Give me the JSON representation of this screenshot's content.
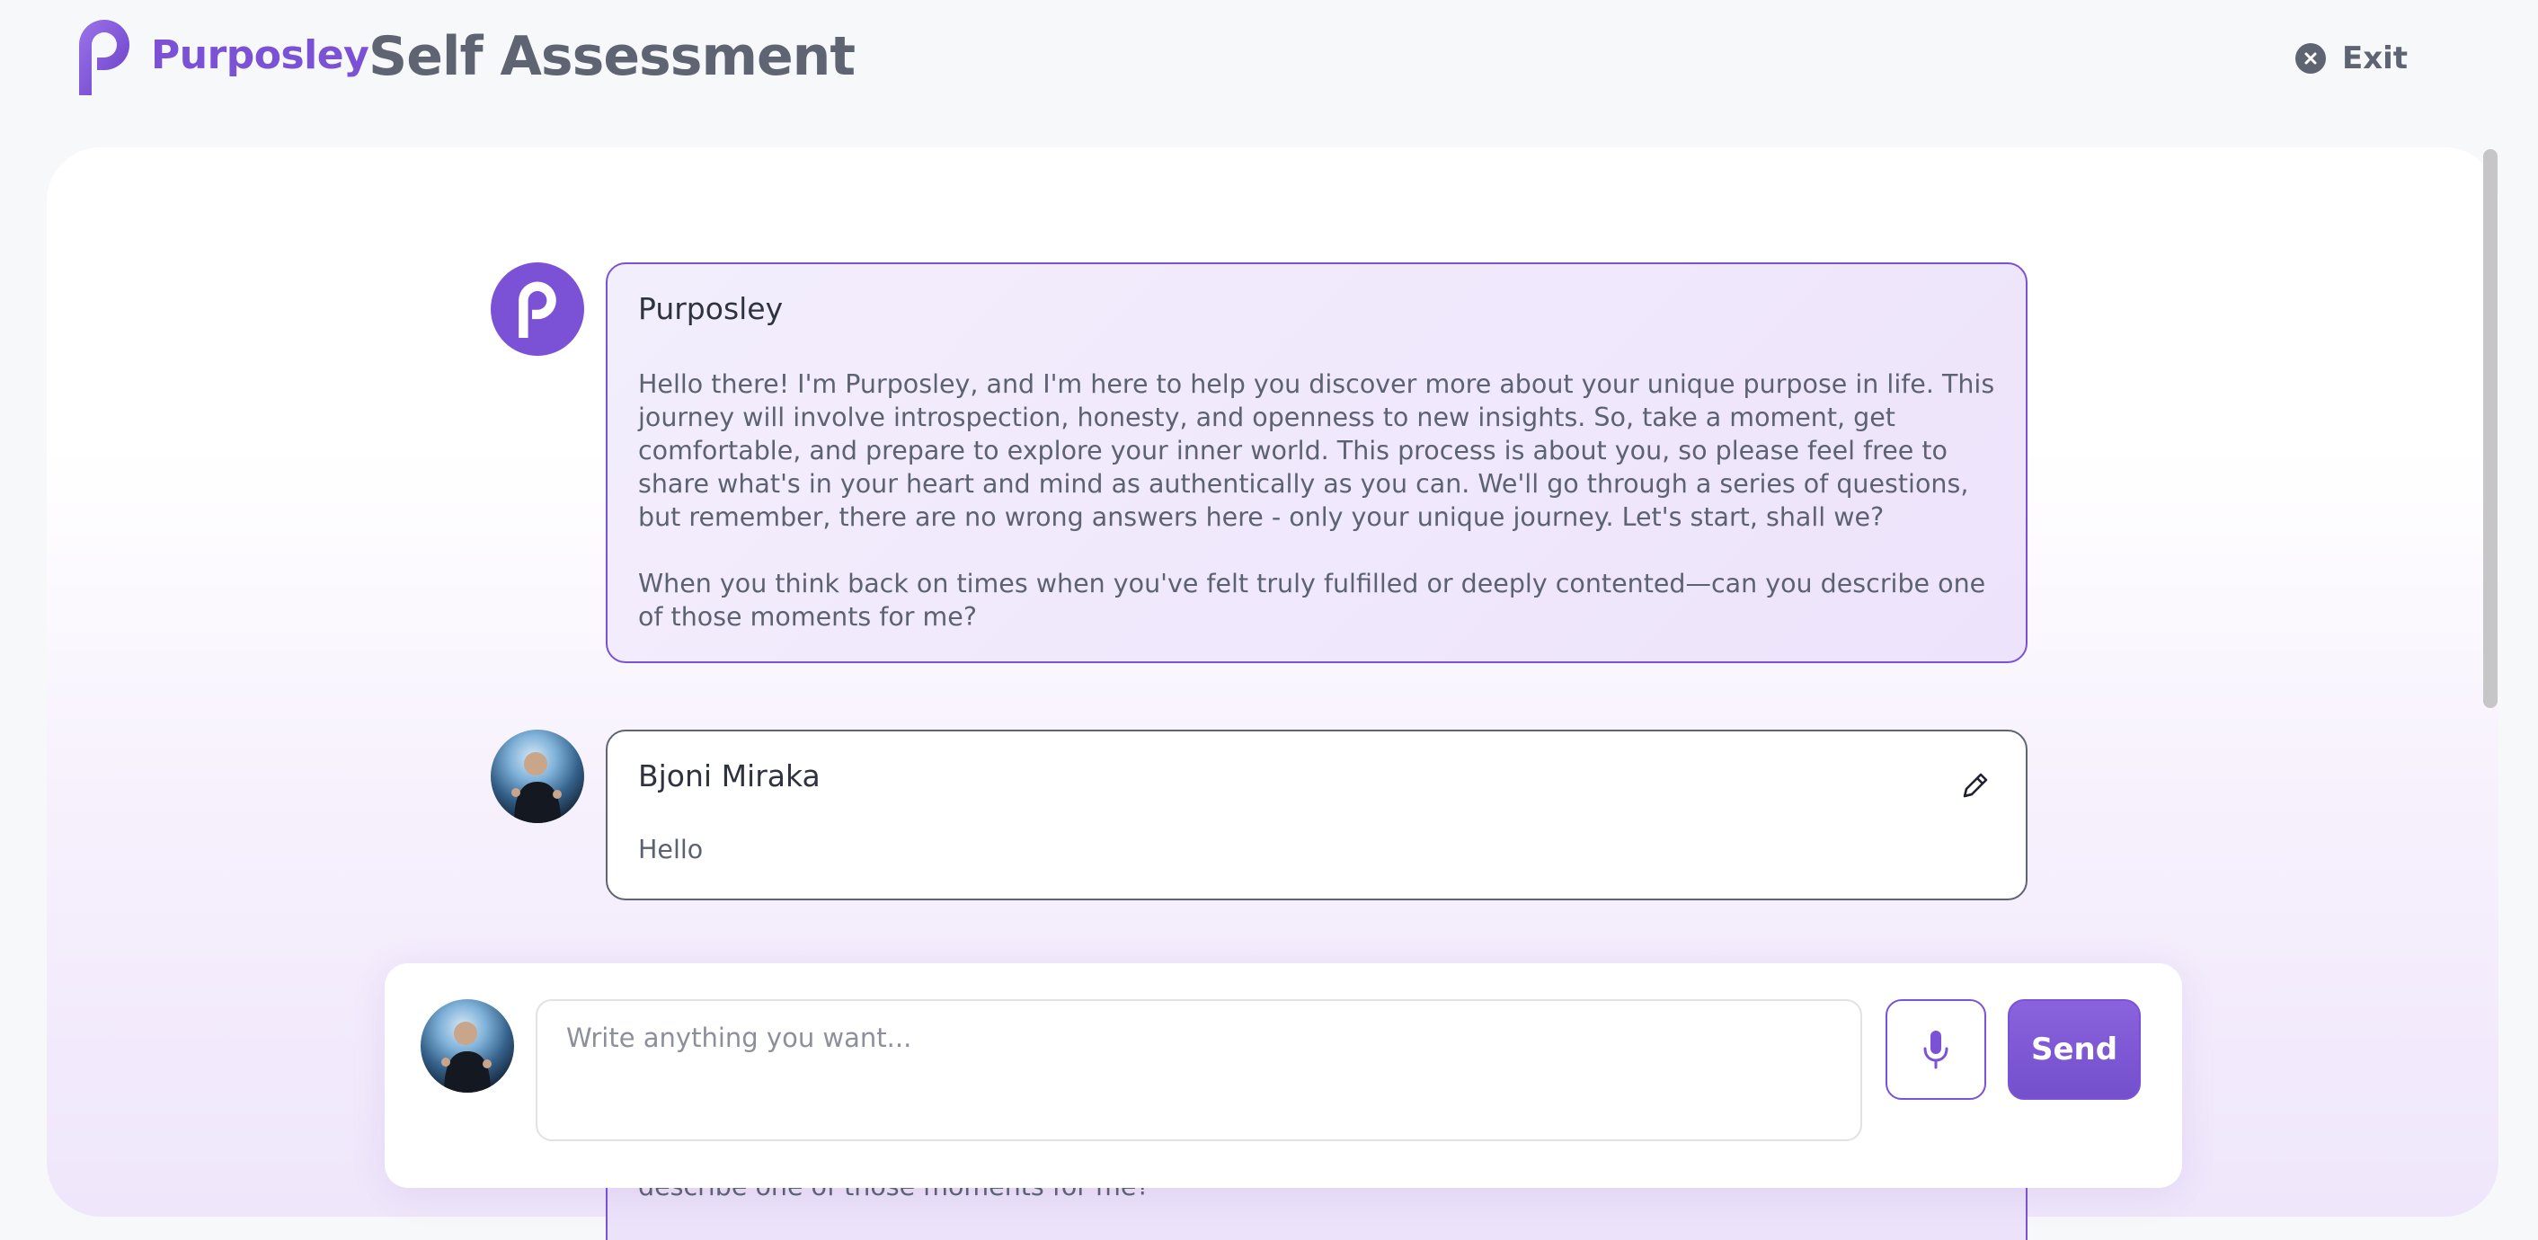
{
  "header": {
    "brand_name": "Purposley",
    "page_title": "Self Assessment",
    "exit_label": "Exit"
  },
  "colors": {
    "brand": "#7b52d6",
    "text": "#5c6270",
    "heading": "#5f6473"
  },
  "messages": [
    {
      "sender": "Purposley",
      "avatar_icon": "purposley-logo-icon",
      "paragraphs": [
        "Hello there! I'm Purposley, and I'm here to help you discover more about your unique purpose in life. This journey will involve introspection, honesty, and openness to new insights. So, take a moment, get comfortable, and prepare to explore your inner world. This process is about you, so please feel free to share what's in your heart and mind as authentically as you can. We'll go through a series of questions, but remember, there are no wrong answers here - only your unique journey. Let's start, shall we?",
        "When you think back on times when you've felt truly fulfilled or deeply contented—can you describe one of those moments for me?"
      ]
    },
    {
      "sender": "Bjoni Miraka",
      "avatar_icon": "user-avatar",
      "text": "Hello",
      "action_icon": "edit-icon"
    }
  ],
  "peek_message": {
    "text": "describe one of those moments for me?"
  },
  "composer": {
    "placeholder": "Write anything you want...",
    "value": "",
    "mic_icon": "microphone-icon",
    "send_label": "Send"
  }
}
